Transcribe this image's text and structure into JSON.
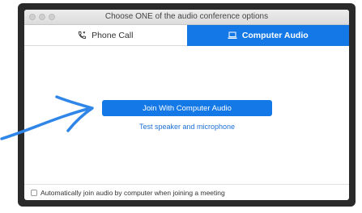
{
  "window": {
    "title": "Choose ONE of the audio conference options"
  },
  "tabs": [
    {
      "label": "Phone Call",
      "icon": "phone-icon",
      "active": false
    },
    {
      "label": "Computer Audio",
      "icon": "laptop-icon",
      "active": true
    }
  ],
  "main": {
    "join_button_label": "Join With Computer Audio",
    "test_link_label": "Test speaker and microphone"
  },
  "footer": {
    "auto_join_label": "Automatically join audio by computer when joining a meeting",
    "auto_join_checked": false
  },
  "colors": {
    "accent": "#1479e6",
    "arrow": "#2f86e8"
  }
}
